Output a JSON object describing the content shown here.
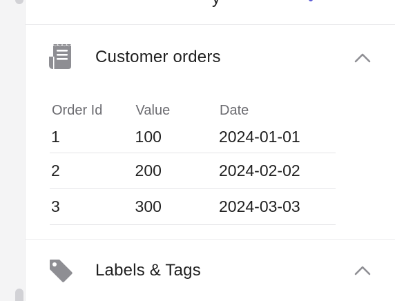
{
  "sections": [
    {
      "title": "Customer orders",
      "icon": "receipt-icon",
      "expanded": true,
      "table": {
        "columns": [
          "Order Id",
          "Value",
          "Date"
        ],
        "rows": [
          [
            "1",
            "100",
            "2024-01-01"
          ],
          [
            "2",
            "200",
            "2024-02-02"
          ],
          [
            "3",
            "300",
            "2024-03-03"
          ]
        ]
      }
    },
    {
      "title": "Labels & Tags",
      "icon": "tag-icon",
      "expanded": true
    }
  ],
  "colors": {
    "icon": "#8e8e93",
    "chevron": "#8e8e93",
    "header_text": "#6b6b70",
    "divider": "#ececee",
    "rail": "#f4f4f5"
  }
}
